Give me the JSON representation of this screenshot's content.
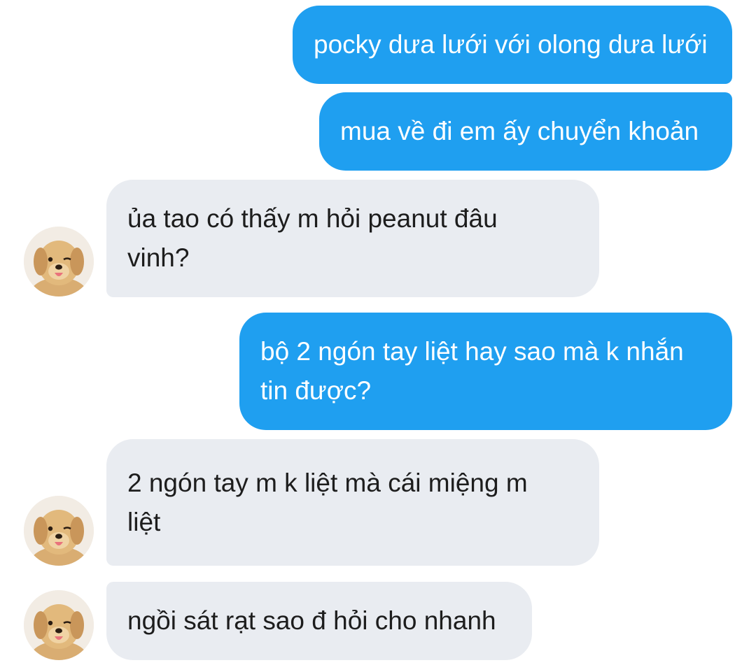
{
  "colors": {
    "sent_bubble": "#1f9ff0",
    "received_bubble": "#e9ecf1",
    "sent_text": "#ffffff",
    "received_text": "#1d1d1d"
  },
  "messages": [
    {
      "direction": "sent",
      "text": "pocky dưa lưới với olong dưa lưới"
    },
    {
      "direction": "sent",
      "text": "mua về đi em ấy chuyển khoản"
    },
    {
      "direction": "received",
      "text": "ủa tao có thấy m hỏi peanut đâu\nvinh?",
      "avatar_icon": "golden-retriever-puppy-avatar"
    },
    {
      "direction": "sent",
      "text": "bộ 2 ngón tay liệt hay sao mà k nhắn\ntin được?"
    },
    {
      "direction": "received",
      "text": "2 ngón tay m k liệt mà cái miệng m\nliệt",
      "avatar_icon": "golden-retriever-puppy-avatar"
    },
    {
      "direction": "received",
      "text": "ngồi sát rạt sao đ hỏi cho nhanh",
      "avatar_icon": "golden-retriever-puppy-avatar"
    }
  ]
}
